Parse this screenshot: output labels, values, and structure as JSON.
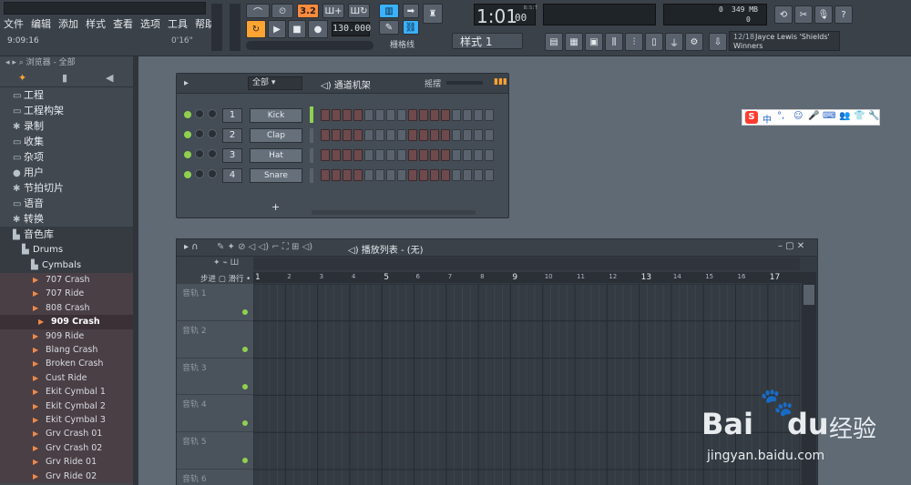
{
  "menu": [
    "文件",
    "编辑",
    "添加",
    "样式",
    "查看",
    "选项",
    "工具",
    "帮助"
  ],
  "status": {
    "time": "9:09:16",
    "offset": "0'16\""
  },
  "transport": {
    "tempo": "130.000",
    "song_time": "1:01",
    "song_time_frac": "00",
    "bst": "B:S:T",
    "pattern": "样式 1",
    "cpu_led": "3.2",
    "grid_snap": "栅格线",
    "memory": "349 MB",
    "cpu_val": "0",
    "voices": "0"
  },
  "song_info": {
    "index": "12/18",
    "title": "Jayce Lewis 'Shields'",
    "subtitle": "Winners"
  },
  "browser": {
    "header": "浏览器 - 全部",
    "items": [
      {
        "icon": "folder-icon",
        "label": "工程"
      },
      {
        "icon": "folder-icon",
        "label": "工程构架"
      },
      {
        "icon": "record-icon",
        "label": "录制"
      },
      {
        "icon": "folder-icon",
        "label": "收集"
      },
      {
        "icon": "folder-icon",
        "label": "杂项"
      },
      {
        "icon": "user-icon",
        "label": "用户"
      },
      {
        "icon": "beat-icon",
        "label": "节拍切片"
      },
      {
        "icon": "folder-icon",
        "label": "语音"
      },
      {
        "icon": "convert-icon",
        "label": "转换"
      },
      {
        "icon": "library-icon",
        "label": "音色库"
      }
    ],
    "drums": "Drums",
    "cymbals": "Cymbals",
    "samples": [
      "707 Crash",
      "707 Ride",
      "808 Crash",
      "909 Crash",
      "909 Ride",
      "Blang Crash",
      "Broken Crash",
      "Cust Ride",
      "Ekit Cymbal 1",
      "Ekit Cymbal 2",
      "Ekit Cymbal 3",
      "Grv Crash 01",
      "Grv Crash 02",
      "Grv Ride 01",
      "Grv Ride 02"
    ],
    "active_sample": "909 Crash"
  },
  "rack": {
    "title": "通道机架",
    "filter": "全部",
    "swing_label": "摇摆",
    "add": "+",
    "channels": [
      {
        "num": "1",
        "name": "Kick"
      },
      {
        "num": "2",
        "name": "Clap"
      },
      {
        "num": "3",
        "name": "Hat"
      },
      {
        "num": "4",
        "name": "Snare"
      }
    ]
  },
  "playlist": {
    "title": "播放列表 - (无)",
    "step_label": "步进",
    "slide_label": "滑行",
    "bars": [
      "1",
      "2",
      "3",
      "4",
      "5",
      "6",
      "7",
      "8",
      "9",
      "10",
      "11",
      "12",
      "13",
      "14",
      "15",
      "16",
      "17"
    ],
    "tracks": [
      "音轨 1",
      "音轨 2",
      "音轨 3",
      "音轨 4",
      "音轨 5",
      "音轨 6"
    ]
  },
  "ime": {
    "label": "中"
  },
  "watermark": {
    "brand": "Bai",
    "brand2": "du",
    "cn": "经验",
    "url": "jingyan.baidu.com"
  }
}
